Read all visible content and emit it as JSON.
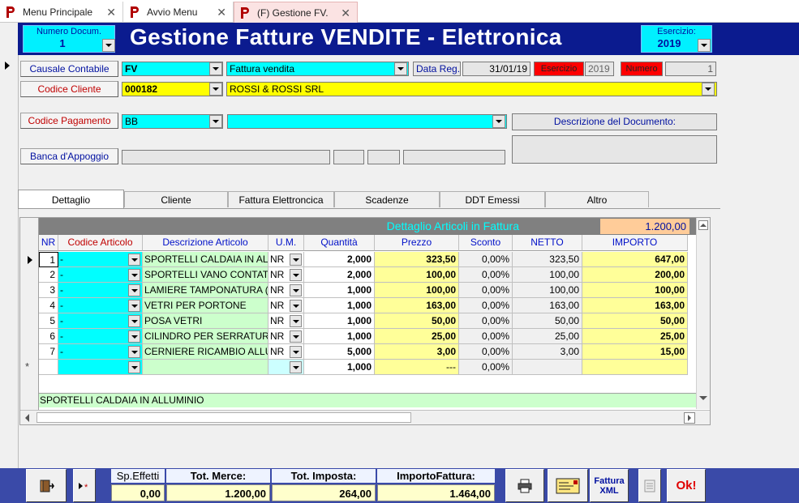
{
  "tabs": [
    {
      "label": "Menu Principale"
    },
    {
      "label": "Avvio Menu"
    },
    {
      "label": "(F) Gestione FV."
    }
  ],
  "header": {
    "title": "Gestione Fatture VENDITE - Elettronica",
    "numero_docum_label": "Numero Docum.",
    "numero_docum_value": "1",
    "esercizio_label": "Esercizio:",
    "esercizio_value": "2019"
  },
  "form": {
    "causale_label": "Causale Contabile",
    "causale_code": "FV",
    "causale_desc": "Fattura vendita",
    "data_reg_label": "Data Reg.",
    "data_reg_value": "31/01/19",
    "esercizio_label": "Esercizio",
    "esercizio_value": "2019",
    "numero_label": "Numero",
    "numero_value": "1",
    "cliente_label": "Codice Cliente",
    "cliente_code": "000182",
    "cliente_name": "ROSSI & ROSSI SRL",
    "pagamento_label": "Codice Pagamento",
    "pagamento_code": "BB",
    "pagamento_desc": "",
    "descrizione_doc_label": "Descrizione del Documento:",
    "banca_label": "Banca d'Appoggio"
  },
  "subtabs": [
    "Dettaglio",
    "Cliente",
    "Fattura Elettroncica",
    "Scadenze",
    "DDT Emessi",
    "Altro"
  ],
  "grid": {
    "title": "Dettaglio Articoli in Fattura",
    "total": "1.200,00",
    "columns": [
      "NR",
      "Codice Articolo",
      "Descrizione Articolo",
      "U.M.",
      "Quantità",
      "Prezzo",
      "Sconto",
      "NETTO",
      "IMPORTO"
    ],
    "rows": [
      {
        "nr": "1",
        "codice": "-",
        "descrizione": "SPORTELLI CALDAIA IN AL",
        "um": "NR",
        "quantita": "2,000",
        "prezzo": "323,50",
        "sconto": "0,00%",
        "netto": "323,50",
        "importo": "647,00"
      },
      {
        "nr": "2",
        "codice": "-",
        "descrizione": "SPORTELLI VANO CONTAT",
        "um": "NR",
        "quantita": "2,000",
        "prezzo": "100,00",
        "sconto": "0,00%",
        "netto": "100,00",
        "importo": "200,00"
      },
      {
        "nr": "3",
        "codice": "-",
        "descrizione": "LAMIERE TAMPONATURA (",
        "um": "NR",
        "quantita": "1,000",
        "prezzo": "100,00",
        "sconto": "0,00%",
        "netto": "100,00",
        "importo": "100,00"
      },
      {
        "nr": "4",
        "codice": "-",
        "descrizione": "VETRI PER PORTONE",
        "um": "NR",
        "quantita": "1,000",
        "prezzo": "163,00",
        "sconto": "0,00%",
        "netto": "163,00",
        "importo": "163,00"
      },
      {
        "nr": "5",
        "codice": "-",
        "descrizione": "POSA VETRI",
        "um": "NR",
        "quantita": "1,000",
        "prezzo": "50,00",
        "sconto": "0,00%",
        "netto": "50,00",
        "importo": "50,00"
      },
      {
        "nr": "6",
        "codice": "-",
        "descrizione": "CILINDRO PER SERRATURA",
        "um": "NR",
        "quantita": "1,000",
        "prezzo": "25,00",
        "sconto": "0,00%",
        "netto": "25,00",
        "importo": "25,00"
      },
      {
        "nr": "7",
        "codice": "-",
        "descrizione": "CERNIERE RICAMBIO ALLUI",
        "um": "NR",
        "quantita": "5,000",
        "prezzo": "3,00",
        "sconto": "0,00%",
        "netto": "3,00",
        "importo": "15,00"
      }
    ],
    "new_row": {
      "marker": "*",
      "quantita": "1,000",
      "prezzo": "---",
      "sconto": "0,00%"
    },
    "footer_desc": "SPORTELLI CALDAIA IN ALLUMINIO"
  },
  "footer": {
    "sp_effetti_label": "Sp.Effetti",
    "sp_effetti_value": "0,00",
    "tot_merce_label": "Tot. Merce:",
    "tot_merce_value": "1.200,00",
    "tot_imposta_label": "Tot. Imposta:",
    "tot_imposta_value": "264,00",
    "importo_label": "ImportoFattura:",
    "importo_value": "1.464,00",
    "fattura_xml_label": "Fattura XML",
    "ok_label": "Ok!"
  },
  "icons": [
    "app-p-icon",
    "close-icon",
    "exit-icon",
    "new-record-icon",
    "printer-icon",
    "envelope-icon",
    "list-icon"
  ]
}
